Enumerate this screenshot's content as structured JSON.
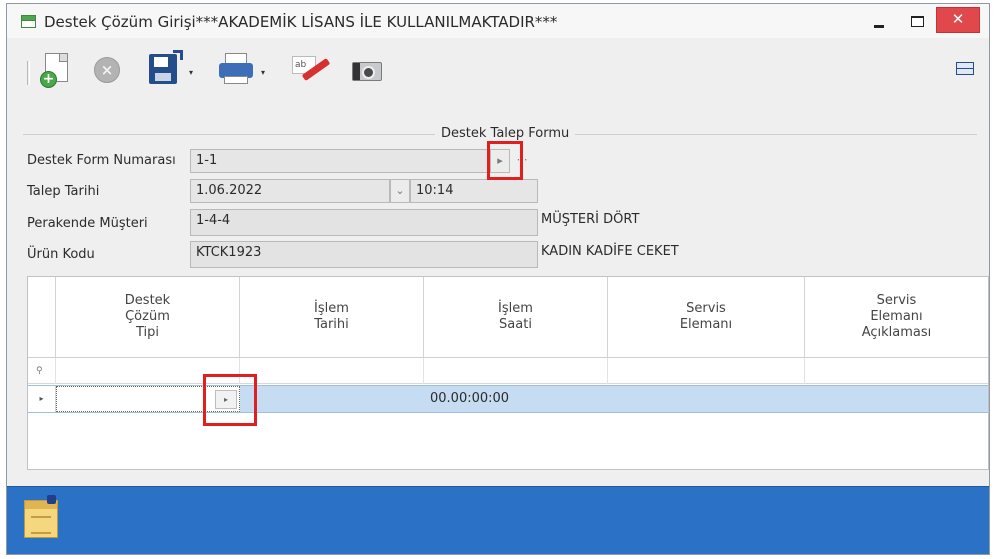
{
  "window": {
    "title": "Destek Çözüm Girişi***AKADEMİK LİSANS İLE KULLANILMAKTADIR***",
    "close_glyph": "✕"
  },
  "toolbar": {
    "icons": [
      "new-document-icon",
      "cancel-icon",
      "save-icon",
      "print-icon",
      "edit-icon",
      "camera-icon",
      "fit-width-icon"
    ],
    "dropdown_glyph": "▾"
  },
  "form": {
    "group_title": "Destek Talep Formu",
    "fields": {
      "form_number": {
        "label": "Destek Form Numarası",
        "value": "1-1"
      },
      "request_date": {
        "label": "Talep Tarihi",
        "date": "1.06.2022",
        "time": "10:14"
      },
      "customer": {
        "label": "Perakende Müşteri",
        "value": "1-4-4",
        "name": "MÜŞTERİ DÖRT"
      },
      "product": {
        "label": "Ürün Kodu",
        "value": "KTCK1923",
        "name": "KADIN KADİFE CEKET"
      }
    },
    "buttons": {
      "lookup_glyph": "▸",
      "ellipsis_glyph": "⋯",
      "dropdown_glyph": "⌄"
    }
  },
  "grid": {
    "columns": [
      {
        "header": "Destek\nÇözüm\nTipi"
      },
      {
        "header": "İşlem\nTarihi"
      },
      {
        "header": "İşlem\nSaati"
      },
      {
        "header": "Servis\nElemanı"
      },
      {
        "header": "Servis\nElemanı\nAçıklaması"
      }
    ],
    "filter_icon": "⚲",
    "row_indicator": "▸",
    "rows": [
      {
        "type": "",
        "date": "",
        "time": "00.00:00:00",
        "staff": "",
        "note": ""
      }
    ]
  },
  "statusbar": {
    "icon": "note-icon"
  },
  "colors": {
    "accent": "#2b72c6",
    "selected_row": "#c5dcf2",
    "highlight": "#e02020",
    "close_button": "#e0484b"
  }
}
